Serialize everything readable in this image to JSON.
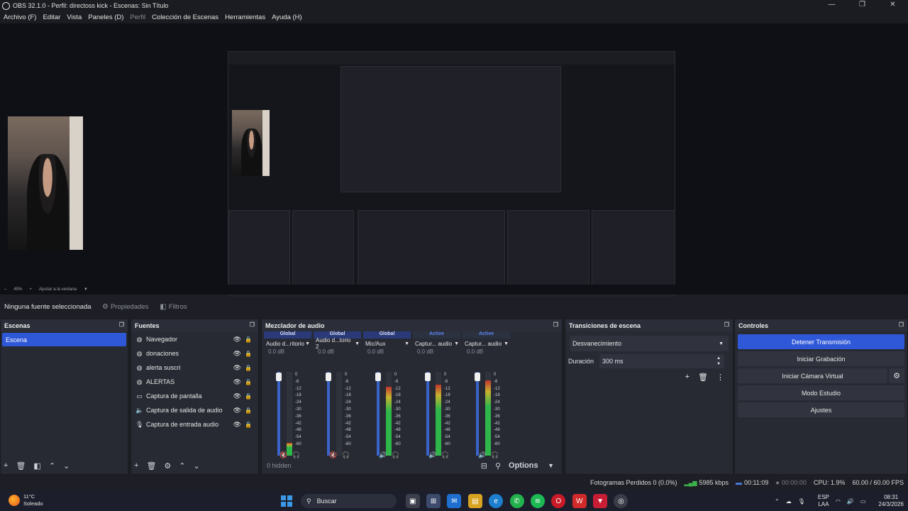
{
  "window": {
    "title": "OBS 32.1.0 - Perfil: directoss kick - Escenas: Sin Título",
    "controls": [
      "—",
      "❐",
      "✕"
    ]
  },
  "menu": [
    "Archivo (F)",
    "Editar",
    "Vista",
    "Paneles (D)",
    "Perfil",
    "Colección de Escenas",
    "Herramientas",
    "Ayuda (H)"
  ],
  "zoom": {
    "minus": "–",
    "value": "49%",
    "plus": "+",
    "fit_label": "Ajustar a la ventana",
    "arrow": "▼"
  },
  "context": {
    "no_source": "Ninguna fuente seleccionada",
    "properties": "Propiedades",
    "filters": "Filtros"
  },
  "scenes": {
    "title": "Escenas",
    "items": [
      "Escena"
    ]
  },
  "sources": {
    "title": "Fuentes",
    "items": [
      {
        "icon": "browser-icon",
        "glyph": "◍",
        "label": "Navegador"
      },
      {
        "icon": "browser-icon",
        "glyph": "◍",
        "label": "donaciones"
      },
      {
        "icon": "browser-icon",
        "glyph": "◍",
        "label": "alerta suscri"
      },
      {
        "icon": "browser-icon",
        "glyph": "◍",
        "label": "ALERTAS"
      },
      {
        "icon": "monitor-icon",
        "glyph": "▭",
        "label": "Captura de pantalla"
      },
      {
        "icon": "speaker-icon",
        "glyph": "🔈",
        "label": "Captura de salida de audio"
      },
      {
        "icon": "microphone-icon",
        "glyph": "🎙",
        "label": "Captura de entrada audio"
      }
    ]
  },
  "mixer": {
    "title": "Mezclador de audio",
    "channels": [
      {
        "tag": "Global",
        "active": false,
        "name": "Audio d...ritorio",
        "db": "0.0 dB",
        "level": 0.15,
        "muted": true
      },
      {
        "tag": "Global",
        "active": false,
        "name": "Audio d...torio 2",
        "db": "0.0 dB",
        "level": 0.0,
        "muted": true
      },
      {
        "tag": "Global",
        "active": false,
        "name": "Mic/Aux",
        "db": "0.0 dB",
        "level": 0.82,
        "muted": false
      },
      {
        "tag": "Active",
        "active": true,
        "name": "Captur... audio",
        "db": "0.0 dB",
        "level": 0.85,
        "muted": false
      },
      {
        "tag": "Active",
        "active": true,
        "name": "Captur... audio",
        "db": "0.0 dB",
        "level": 0.9,
        "muted": false
      }
    ],
    "scale": [
      "0",
      "-6",
      "-12",
      "-18",
      "-24",
      "-30",
      "-36",
      "-42",
      "-48",
      "-54",
      "-60"
    ],
    "hidden": "0 hidden",
    "options": "Options"
  },
  "transitions": {
    "title": "Transiciones de escena",
    "selected": "Desvanecimiento",
    "duration_label": "Duración",
    "duration_value": "300 ms"
  },
  "controls": {
    "title": "Controles",
    "stop_stream": "Detener Transmisión",
    "start_record": "Iniciar Grabación",
    "virtual_cam": "Iniciar Cámara Virtual",
    "studio": "Modo Estudio",
    "settings": "Ajustes"
  },
  "status": {
    "dropped": "Fotogramas Perdidos 0 (0.0%)",
    "bitrate": "5985 kbps",
    "live_time": "00:11:09",
    "rec_time": "00:00:00",
    "cpu": "CPU: 1.9%",
    "fps": "60.00 / 60.00 FPS"
  },
  "taskbar": {
    "temp": "11°C",
    "weather": "Soleado",
    "search": "Buscar",
    "lang1": "ESP",
    "lang2": "LAA",
    "time": "08:31",
    "date": "24/3/2026"
  },
  "colors": {
    "accent": "#2f58d8",
    "meter_green": "#2fb64a",
    "meter_yellow": "#c7b12f",
    "meter_red": "#c0352f"
  }
}
